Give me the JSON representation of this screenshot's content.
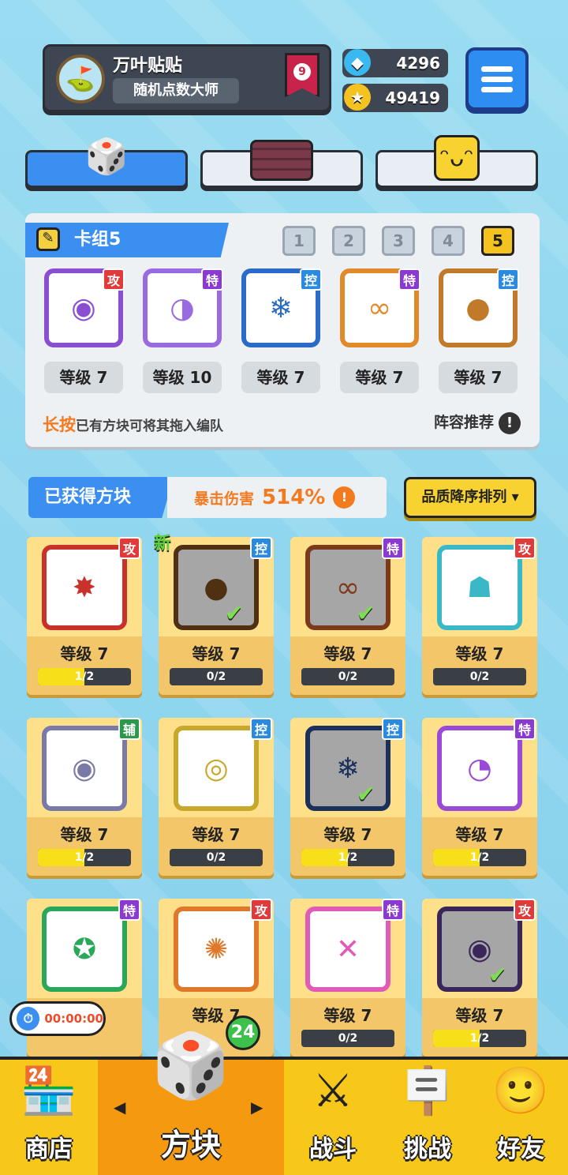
{
  "player": {
    "name": "万叶贴贴",
    "title": "随机点数大师",
    "rank": "9"
  },
  "currency": {
    "gems": "4296",
    "coins": "49419"
  },
  "tabs": [
    {
      "name": "dice"
    },
    {
      "name": "board"
    },
    {
      "name": "emote"
    }
  ],
  "deck": {
    "label": "卡组5",
    "numbers": [
      "1",
      "2",
      "3",
      "4",
      "5"
    ],
    "selected": "5",
    "cards": [
      {
        "tag": "攻",
        "tag_color": "#e03a3a",
        "frame": "#8a4fd1",
        "icon": "◉",
        "level": "等级 7"
      },
      {
        "tag": "特",
        "tag_color": "#8a3ad1",
        "frame": "#9a6ae0",
        "icon": "◑",
        "level": "等级 10"
      },
      {
        "tag": "控",
        "tag_color": "#2a8ae0",
        "frame": "#2a6ac8",
        "icon": "❄",
        "level": "等级 7"
      },
      {
        "tag": "特",
        "tag_color": "#8a3ad1",
        "frame": "#e08a2a",
        "icon": "∞",
        "level": "等级 7"
      },
      {
        "tag": "控",
        "tag_color": "#2a8ae0",
        "frame": "#c07a2a",
        "icon": "●",
        "level": "等级 7"
      }
    ],
    "hint_em": "长按",
    "hint": "已有方块可将其拖入编队",
    "recommend": "阵容推荐"
  },
  "obtained": {
    "label": "已获得方块",
    "crit_label": "暴击伤害",
    "crit_value": "514%",
    "sort": "品质降序排列"
  },
  "grid": [
    {
      "tag": "攻",
      "tag_color": "#e03a3a",
      "frame": "#c8322a",
      "icon": "✸",
      "level": "等级 7",
      "progress": "1/2",
      "fill": 0.5,
      "dim": false,
      "check": false,
      "new": ""
    },
    {
      "tag": "控",
      "tag_color": "#2a8ae0",
      "frame": "#7a4a1a",
      "icon": "●",
      "level": "等级 7",
      "progress": "0/2",
      "fill": 0,
      "dim": true,
      "check": true,
      "new": "新"
    },
    {
      "tag": "特",
      "tag_color": "#8a3ad1",
      "frame": "#c05a2a",
      "icon": "∞",
      "level": "等级 7",
      "progress": "0/2",
      "fill": 0,
      "dim": true,
      "check": true,
      "new": ""
    },
    {
      "tag": "攻",
      "tag_color": "#e03a3a",
      "frame": "#3ab8c8",
      "icon": "☗",
      "level": "等级 7",
      "progress": "0/2",
      "fill": 0,
      "dim": false,
      "check": false,
      "new": ""
    },
    {
      "tag": "辅",
      "tag_color": "#2a9a4a",
      "frame": "#7a7aa8",
      "icon": "◉",
      "level": "等级 7",
      "progress": "1/2",
      "fill": 0.5,
      "dim": false,
      "check": false,
      "new": ""
    },
    {
      "tag": "控",
      "tag_color": "#2a8ae0",
      "frame": "#c8a82a",
      "icon": "◎",
      "level": "等级 7",
      "progress": "0/2",
      "fill": 0,
      "dim": false,
      "check": false,
      "new": ""
    },
    {
      "tag": "控",
      "tag_color": "#2a8ae0",
      "frame": "#2a4a8a",
      "icon": "❄",
      "level": "等级 7",
      "progress": "1/2",
      "fill": 0.5,
      "dim": true,
      "check": true,
      "new": ""
    },
    {
      "tag": "特",
      "tag_color": "#8a3ad1",
      "frame": "#9a4ad8",
      "icon": "◔",
      "level": "等级 7",
      "progress": "1/2",
      "fill": 0.5,
      "dim": false,
      "check": false,
      "new": ""
    },
    {
      "tag": "特",
      "tag_color": "#8a3ad1",
      "frame": "#2aa85a",
      "icon": "✪",
      "level": "",
      "progress": "",
      "fill": 0,
      "dim": false,
      "check": false,
      "new": ""
    },
    {
      "tag": "攻",
      "tag_color": "#e03a3a",
      "frame": "#e0782a",
      "icon": "✺",
      "level": "等级 7",
      "progress": "",
      "fill": 0,
      "dim": false,
      "check": false,
      "new": ""
    },
    {
      "tag": "特",
      "tag_color": "#8a3ad1",
      "frame": "#e05ab8",
      "icon": "✕",
      "level": "等级 7",
      "progress": "0/2",
      "fill": 0,
      "dim": false,
      "check": false,
      "new": ""
    },
    {
      "tag": "攻",
      "tag_color": "#e03a3a",
      "frame": "#5a3a8a",
      "icon": "◉",
      "level": "等级 7",
      "progress": "1/2",
      "fill": 0.5,
      "dim": true,
      "check": true,
      "new": ""
    }
  ],
  "timer": "00:00:00",
  "nav": {
    "items": [
      {
        "label": "商店",
        "icon": "🏪"
      },
      {
        "label": "方块",
        "icon": "🎲"
      },
      {
        "label": "战斗",
        "icon": "⚔"
      },
      {
        "label": "挑战",
        "icon": "🪧"
      },
      {
        "label": "好友",
        "icon": "🙂"
      }
    ],
    "badge": "24"
  }
}
